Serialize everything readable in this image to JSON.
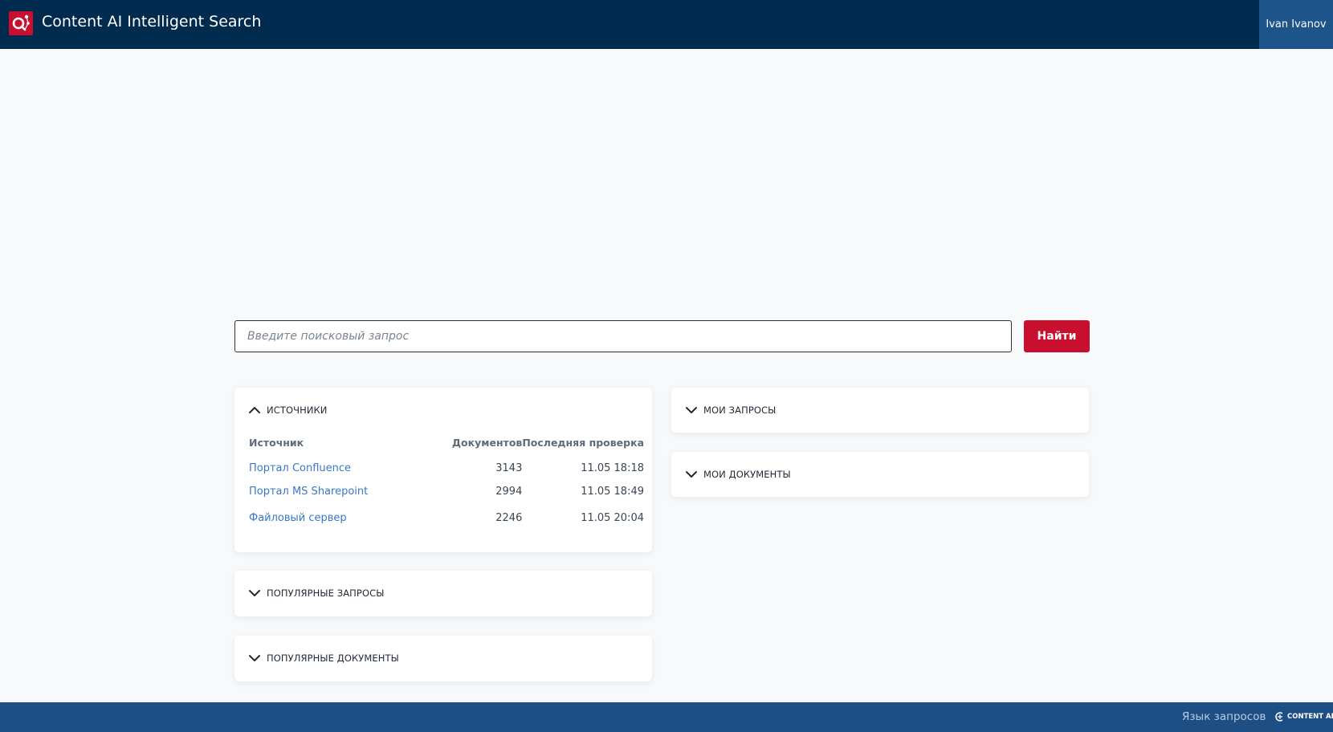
{
  "header": {
    "app_title": "Content AI Intelligent Search",
    "user_name": "Ivan Ivanov"
  },
  "search": {
    "placeholder": "Введите поисковый запрос",
    "button_label": "Найти"
  },
  "panels": {
    "sources": {
      "title": "ИСТОЧНИКИ",
      "expanded": true,
      "columns": [
        "Источник",
        "Документов",
        "Последняя проверка"
      ],
      "rows": [
        {
          "name": "Портал Confluence",
          "documents": "3143",
          "last_check": "11.05 18:18"
        },
        {
          "name": "Портал MS Sharepoint",
          "documents": "2994",
          "last_check": "11.05 18:49"
        },
        {
          "name": "Файловый сервер",
          "documents": "2246",
          "last_check": "11.05 20:04"
        }
      ]
    },
    "popular_queries": {
      "title": "ПОПУЛЯРНЫЕ ЗАПРОСЫ",
      "expanded": false
    },
    "popular_documents": {
      "title": "ПОПУЛЯРНЫЕ ДОКУМЕНТЫ",
      "expanded": false
    },
    "my_queries": {
      "title": "МОИ ЗАПРОСЫ",
      "expanded": false
    },
    "my_documents": {
      "title": "МОИ ДОКУМЕНТЫ",
      "expanded": false
    }
  },
  "footer": {
    "query_language_link": "Язык запросов",
    "brand": "CONTENT AI"
  },
  "colors": {
    "header_bg": "#002b4e",
    "user_bg": "#1d5489",
    "accent_red": "#c8102e",
    "footer_bg": "#1d4f84",
    "link": "#3b78c4",
    "page_bg": "#f7f9fb"
  },
  "icons": {
    "logo": "content-ai-logo-icon",
    "expand": "chevron-down-icon",
    "collapse": "chevron-up-icon"
  }
}
